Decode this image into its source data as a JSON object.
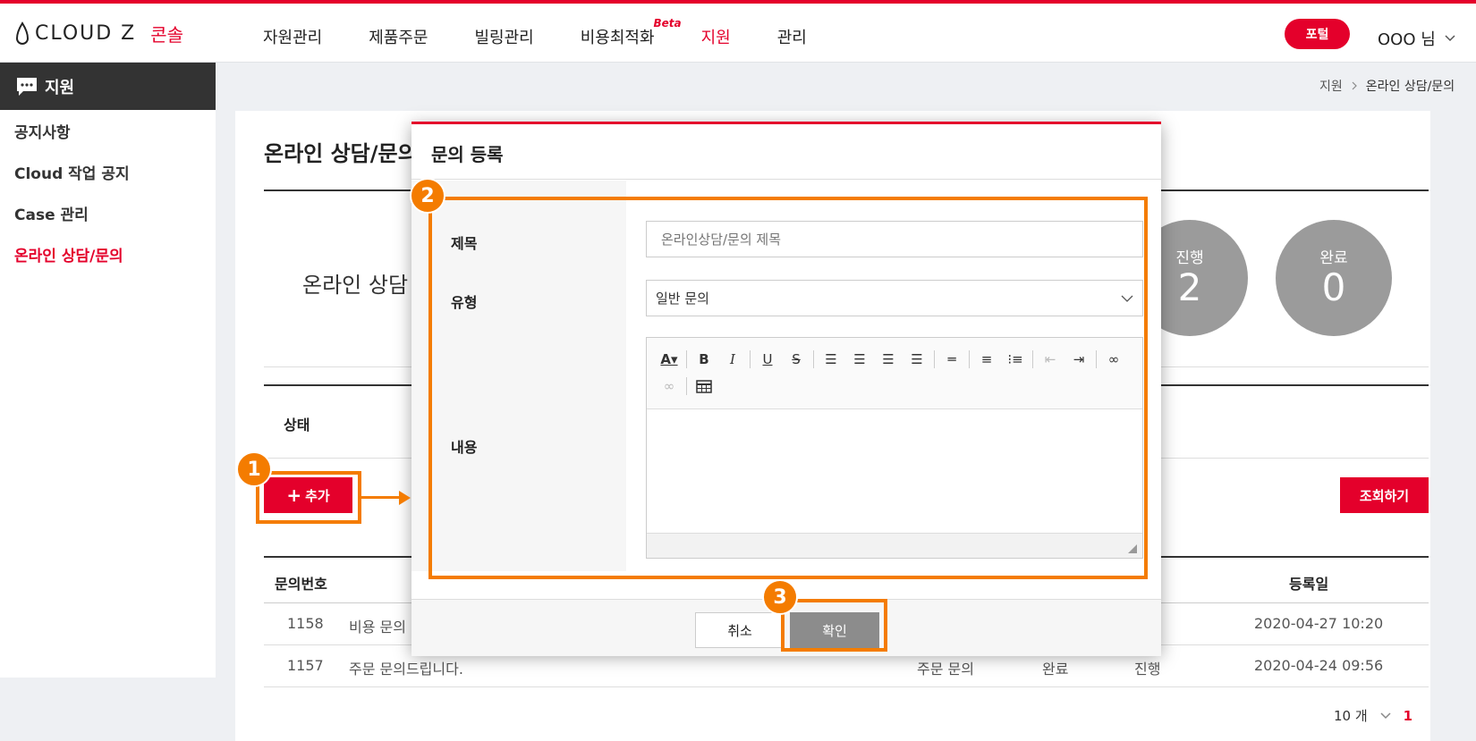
{
  "header": {
    "logo_text": "CLOUD Z",
    "logo_sub": "콘솔",
    "nav": [
      "자원관리",
      "제품주문",
      "빌링관리",
      "비용최적화",
      "지원",
      "관리"
    ],
    "beta_label": "Beta",
    "portal_label": "포털",
    "user_label": "OOO 님"
  },
  "sidebar": {
    "title": "지원",
    "items": [
      "공지사항",
      "Cloud 작업 공지",
      "Case 관리",
      "온라인 상담/문의"
    ]
  },
  "breadcrumb": {
    "root": "지원",
    "current": "온라인 상담/문의"
  },
  "page": {
    "title": "온라인 상담/문의",
    "summary_label": "온라인 상담",
    "stats": [
      {
        "label": "진행",
        "value": "2"
      },
      {
        "label": "완료",
        "value": "0"
      }
    ],
    "filter_label": "상태",
    "add_label": "추가",
    "search_label": "조회하기"
  },
  "table": {
    "col_id": "문의번호",
    "col_date": "등록일",
    "rows": [
      {
        "id": "1158",
        "title": "비용 문의",
        "type": "",
        "status": "",
        "progress": "",
        "date": "2020-04-27 10:20"
      },
      {
        "id": "1157",
        "title": "주문 문의드립니다.",
        "type": "주문 문의",
        "status": "완료",
        "progress": "진행",
        "date": "2020-04-24 09:56"
      }
    ]
  },
  "pager": {
    "size": "10 개",
    "page": "1"
  },
  "modal": {
    "title": "문의 등록",
    "label_subject": "제목",
    "subject_placeholder": "온라인상담/문의 제목",
    "label_type": "유형",
    "type_value": "일반 문의",
    "label_content": "내용",
    "cancel_label": "취소",
    "ok_label": "확인"
  },
  "annotations": {
    "step1": "1",
    "step2": "2",
    "step3": "3",
    "color": "#f47c00"
  },
  "colors": {
    "accent": "#e4002b",
    "sidebar_head": "#333333",
    "stat_circle": "#9b9b9b"
  }
}
